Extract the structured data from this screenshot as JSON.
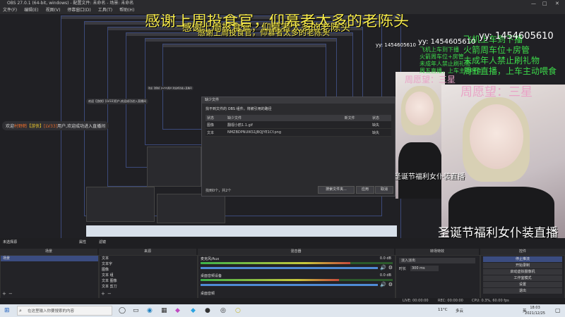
{
  "window": {
    "title": "OBS 27.0.1 (64-bit, windows) - 配置文件: 未命名 - 场景: 未命名",
    "controls": {
      "minimize": "—",
      "maximize": "□",
      "close": "✕"
    }
  },
  "menu": [
    "文件(F)",
    "编辑(E)",
    "视图(V)",
    "停靠窗口(D)",
    "工具(T)",
    "帮助(H)"
  ],
  "overlay": {
    "yellow_top": "感谢上周投食官，仰慕者太多的老陈头",
    "yellow_2": "感谢上周投食官，仰慕者太多的老陈头",
    "yellow_3": "感谢上周投食官，仰慕者太多的老陈头",
    "yy_large": "yy: 1454605610",
    "yy_small": "yy: 1454605610",
    "yy_tiny": "yy: 1454605610",
    "rules_large": [
      "飞机上车到下播",
      "火箭周车位+房管",
      "未成年人禁止刷礼物",
      "周五直播，上车主动喂食"
    ],
    "rules_small": [
      "飞机上车到下播",
      "火箭周车位+房管",
      "未成年人禁止刷礼物",
      "周五直播，上车主动喂食"
    ],
    "wish_large": "周愿望：三星",
    "wish_small": "周愿望：三星",
    "banner_large": "圣诞节福利女仆装直播",
    "banner_small": "圣诞节福利女仆装直播",
    "chat_welcome": {
      "prefix": "欢迎",
      "user": "村野鹤",
      "mid": "【游侠】",
      "rank": "[LV33]",
      "suffix": "用户,欢迎成功进入直播间"
    },
    "chat_welcome_small": "欢迎【游侠】[LV33]用户,欢迎成功进入直播间"
  },
  "dialog": {
    "title": "缺少文件",
    "message": "找不到文件的 OBS 组件。将被引用的路径",
    "columns": [
      "状态",
      "缺少文件",
      "新文件",
      "状态"
    ],
    "rows": [
      {
        "type": "图像",
        "name": "翻视小鹤1.1.gif",
        "new": "",
        "status": "缺失"
      },
      {
        "type": "文本",
        "name": "NMZBDPNUIKS1JBQJYE1Cf.png",
        "new": "",
        "status": "缺失"
      }
    ],
    "found_label": "找到0个，共2个",
    "search_button": "搜索文件夹...",
    "apply_button": "应用",
    "cancel_button": "取消"
  },
  "dock": {
    "titles": {
      "scenes": "场景",
      "sources": "来源",
      "mixer": "混音器",
      "transitions": "转场特效",
      "controls": "控件"
    },
    "preview_label": "未选择源",
    "props_button": "属性",
    "filters_button": "滤镜",
    "scenes": [
      "场景"
    ],
    "sources": [
      "文本",
      "文本字",
      "图像",
      "文本 组",
      "文本 图像",
      "文本 剪刀"
    ],
    "mixer": [
      {
        "name": "麦克风/Aux",
        "db": "0.0 dB",
        "level": 0.78
      },
      {
        "name": "桌面音频设备",
        "db": "0.0 dB",
        "level": 0.72
      },
      {
        "name": "桌面音频",
        "db": "0.0 dB",
        "level": 0.0
      }
    ],
    "transition": {
      "type": "淡入淡出",
      "duration_label": "时长",
      "duration": "300 ms"
    },
    "controls": [
      "停止推流",
      "开始录制",
      "启动虚拟摄像机",
      "工作室模式",
      "设置",
      "退出"
    ]
  },
  "status": {
    "live": "LIVE: 00:00:00",
    "rec": "REC: 00:00:00",
    "cpu": "CPU: 0.3%, 60.00 fps"
  },
  "taskbar": {
    "search_placeholder": "在这里输入你要搜索的内容",
    "temp": "11°C",
    "weather": "多云",
    "ime": "英",
    "time": "18:03",
    "date": "2021/12/25"
  },
  "colors": {
    "accent_yellow": "#f4e84a",
    "accent_green": "#3cd84a",
    "selection": "#3b4c80",
    "pink": "#e9a2c6"
  }
}
